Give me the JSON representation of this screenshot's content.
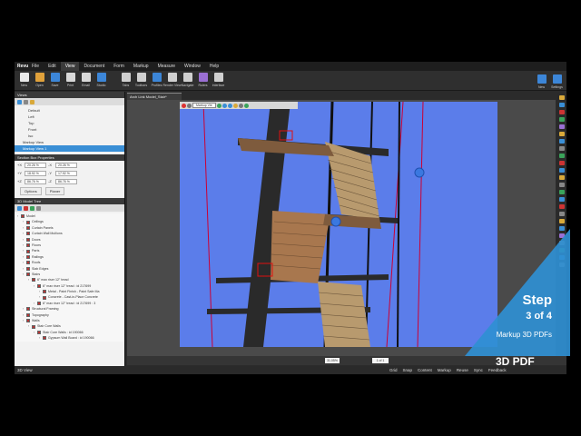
{
  "menu": {
    "logo": "Revu",
    "items": [
      "File",
      "Edit",
      "View",
      "Document",
      "Form",
      "Markup",
      "Measure",
      "Window",
      "Help"
    ],
    "active": "View"
  },
  "toolbar": {
    "buttons": [
      {
        "label": "New",
        "color": "#e8e8e8"
      },
      {
        "label": "Open",
        "color": "#e0a13b"
      },
      {
        "label": "Save",
        "color": "#3c86d8"
      },
      {
        "label": "Print",
        "color": "#d8d8d8"
      },
      {
        "label": "Email",
        "color": "#d8d8d8"
      },
      {
        "label": "Studio",
        "color": "#3c86d8"
      }
    ],
    "buttons2": [
      {
        "label": "Tabs",
        "color": "#d0d0d0"
      },
      {
        "label": "Toolbars",
        "color": "#d0d0d0"
      },
      {
        "label": "Profiles",
        "color": "#3c86d8"
      },
      {
        "label": "Render View",
        "color": "#d0d0d0"
      },
      {
        "label": "Navigate",
        "color": "#d0d0d0"
      },
      {
        "label": "Rulers",
        "color": "#9a6fd3"
      },
      {
        "label": "Interface",
        "color": "#d0d0d0"
      }
    ],
    "right": [
      {
        "label": "New",
        "color": "#3c86d8"
      },
      {
        "label": "Settings",
        "color": "#3c86d8"
      }
    ]
  },
  "views_panel": {
    "header": "Views",
    "items": [
      "Default",
      "Left",
      "Top",
      "Front",
      "Iso",
      "Markup View",
      "Markup View 1"
    ],
    "selected": "Markup View 1"
  },
  "section_box": {
    "header": "Section Box Properties",
    "rows": [
      {
        "a": "+X",
        "v1": "20.26 %",
        "b": "-X",
        "v2": "20.26 %"
      },
      {
        "a": "+Y",
        "v1": "18.92 %",
        "b": "-Y",
        "v2": "17.92 %"
      },
      {
        "a": "+Z",
        "v1": "86.76 %",
        "b": "-Z",
        "v2": "86.76 %"
      }
    ],
    "buttons": [
      "Options",
      "Planer"
    ]
  },
  "model_tree": {
    "header": "3D Model Tree",
    "rows": [
      {
        "indent": 0,
        "text": "Model"
      },
      {
        "indent": 1,
        "text": "Ceilings"
      },
      {
        "indent": 1,
        "text": "Curtain Panels"
      },
      {
        "indent": 1,
        "text": "Curtain Wall Mullions"
      },
      {
        "indent": 1,
        "text": "Doors"
      },
      {
        "indent": 1,
        "text": "Floors"
      },
      {
        "indent": 1,
        "text": "Parts"
      },
      {
        "indent": 1,
        "text": "Railings"
      },
      {
        "indent": 1,
        "text": "Roofs"
      },
      {
        "indent": 1,
        "text": "Slab Edges"
      },
      {
        "indent": 1,
        "text": "Stairs"
      },
      {
        "indent": 2,
        "text": "6\" max riser 12\" tread"
      },
      {
        "indent": 3,
        "text": "6\" max riser 12\" tread : id 217699"
      },
      {
        "indent": 4,
        "text": "Metal - Paint Finish - Paint Safe Ma"
      },
      {
        "indent": 4,
        "text": "Concrete - Cast-in-Place Concrete"
      },
      {
        "indent": 3,
        "text": "6\" max riser 12\" tread : id 217699 : 3"
      },
      {
        "indent": 1,
        "text": "Structural Framing"
      },
      {
        "indent": 1,
        "text": "Topography"
      },
      {
        "indent": 1,
        "text": "Walls"
      },
      {
        "indent": 2,
        "text": "Stair Core Walls"
      },
      {
        "indent": 3,
        "text": "Stair Core Walls : id 190066"
      },
      {
        "indent": 4,
        "text": "Gypsum Wall Board : id 190066"
      }
    ]
  },
  "document": {
    "tab": "Arch Link Model_Stair*",
    "view_selector": "Markup Vie",
    "page": "1 of 1",
    "zoom": "31.05%"
  },
  "statusbar": {
    "left": "3D View",
    "right": [
      "Grid",
      "Snap",
      "Content",
      "Markup",
      "Reuse",
      "Sync",
      "Feedback"
    ]
  },
  "overlay": {
    "step": "Step",
    "count": "3 of 4",
    "subtitle": "Markup 3D PDFs",
    "brand": "3D PDF",
    "color": "#2f8fd3"
  }
}
